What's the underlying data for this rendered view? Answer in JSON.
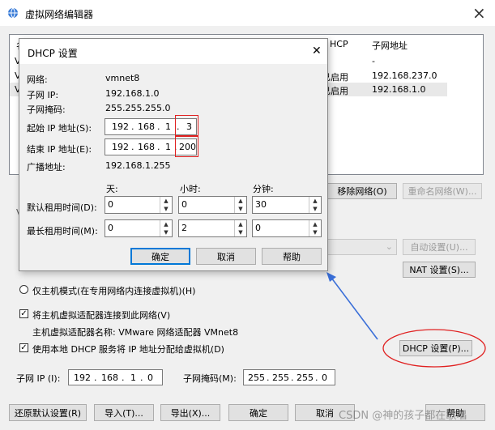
{
  "main": {
    "title": "虚拟网络编辑器",
    "close": "×",
    "table": {
      "col_name": "名",
      "col_dhcp": "HCP",
      "col_subnet": "子网地址",
      "rows": [
        {
          "name": "V",
          "dhcp": "",
          "subnet": "-"
        },
        {
          "name": "V",
          "dhcp": "已启用",
          "subnet": "192.168.237.0"
        },
        {
          "name": "V",
          "dhcp": "已启用",
          "subnet": "192.168.1.0"
        }
      ]
    },
    "remove_network": "移除网络(O)",
    "rename_network": "重命名网络(W)...",
    "auto_settings": "自动设置(U)...",
    "nat_settings": "NAT 设置(S)...",
    "v_label": "V",
    "host_only": "仅主机模式(在专用网络内连接虚拟机)(H)",
    "connect_host": "将主机虚拟适配器连接到此网络(V)",
    "adapter_name": "主机虚拟适配器名称: VMware 网络适配器 VMnet8",
    "use_dhcp": "使用本地 DHCP 服务将 IP 地址分配给虚拟机(D)",
    "dhcp_settings": "DHCP 设置(P)...",
    "subnet_ip_label": "子网 IP (I):",
    "subnet_ip": [
      "192",
      "168",
      "1",
      "0"
    ],
    "subnet_mask_label": "子网掩码(M):",
    "subnet_mask": [
      "255",
      "255",
      "255",
      "0"
    ],
    "footer": {
      "restore": "还原默认设置(R)",
      "import": "导入(T)...",
      "export": "导出(X)...",
      "ok": "确定",
      "cancel": "取消",
      "help": "帮助"
    },
    "watermark": "CSDN @神的孩子都在歌唱"
  },
  "dialog": {
    "title": "DHCP 设置",
    "close": "✕",
    "network_label": "网络:",
    "network_value": "vmnet8",
    "subnet_ip_label": "子网 IP:",
    "subnet_ip_value": "192.168.1.0",
    "subnet_mask_label": "子网掩码:",
    "subnet_mask_value": "255.255.255.0",
    "start_ip_label": "起始 IP 地址(S):",
    "start_ip": [
      "192",
      "168",
      "1",
      "3"
    ],
    "end_ip_label": "结束 IP 地址(E):",
    "end_ip": [
      "192",
      "168",
      "1",
      "200"
    ],
    "broadcast_label": "广播地址:",
    "broadcast_value": "192.168.1.255",
    "col_days": "天:",
    "col_hours": "小时:",
    "col_minutes": "分钟:",
    "default_lease_label": "默认租用时间(D):",
    "default_lease": {
      "days": "0",
      "hours": "0",
      "minutes": "30"
    },
    "max_lease_label": "最长租用时间(M):",
    "max_lease": {
      "days": "0",
      "hours": "2",
      "minutes": "0"
    },
    "ok": "确定",
    "cancel": "取消",
    "help": "帮助"
  },
  "colors": {
    "annotation_red": "#e02020",
    "annotation_blue": "#3a6fd8",
    "focus_blue": "#0078d7"
  }
}
